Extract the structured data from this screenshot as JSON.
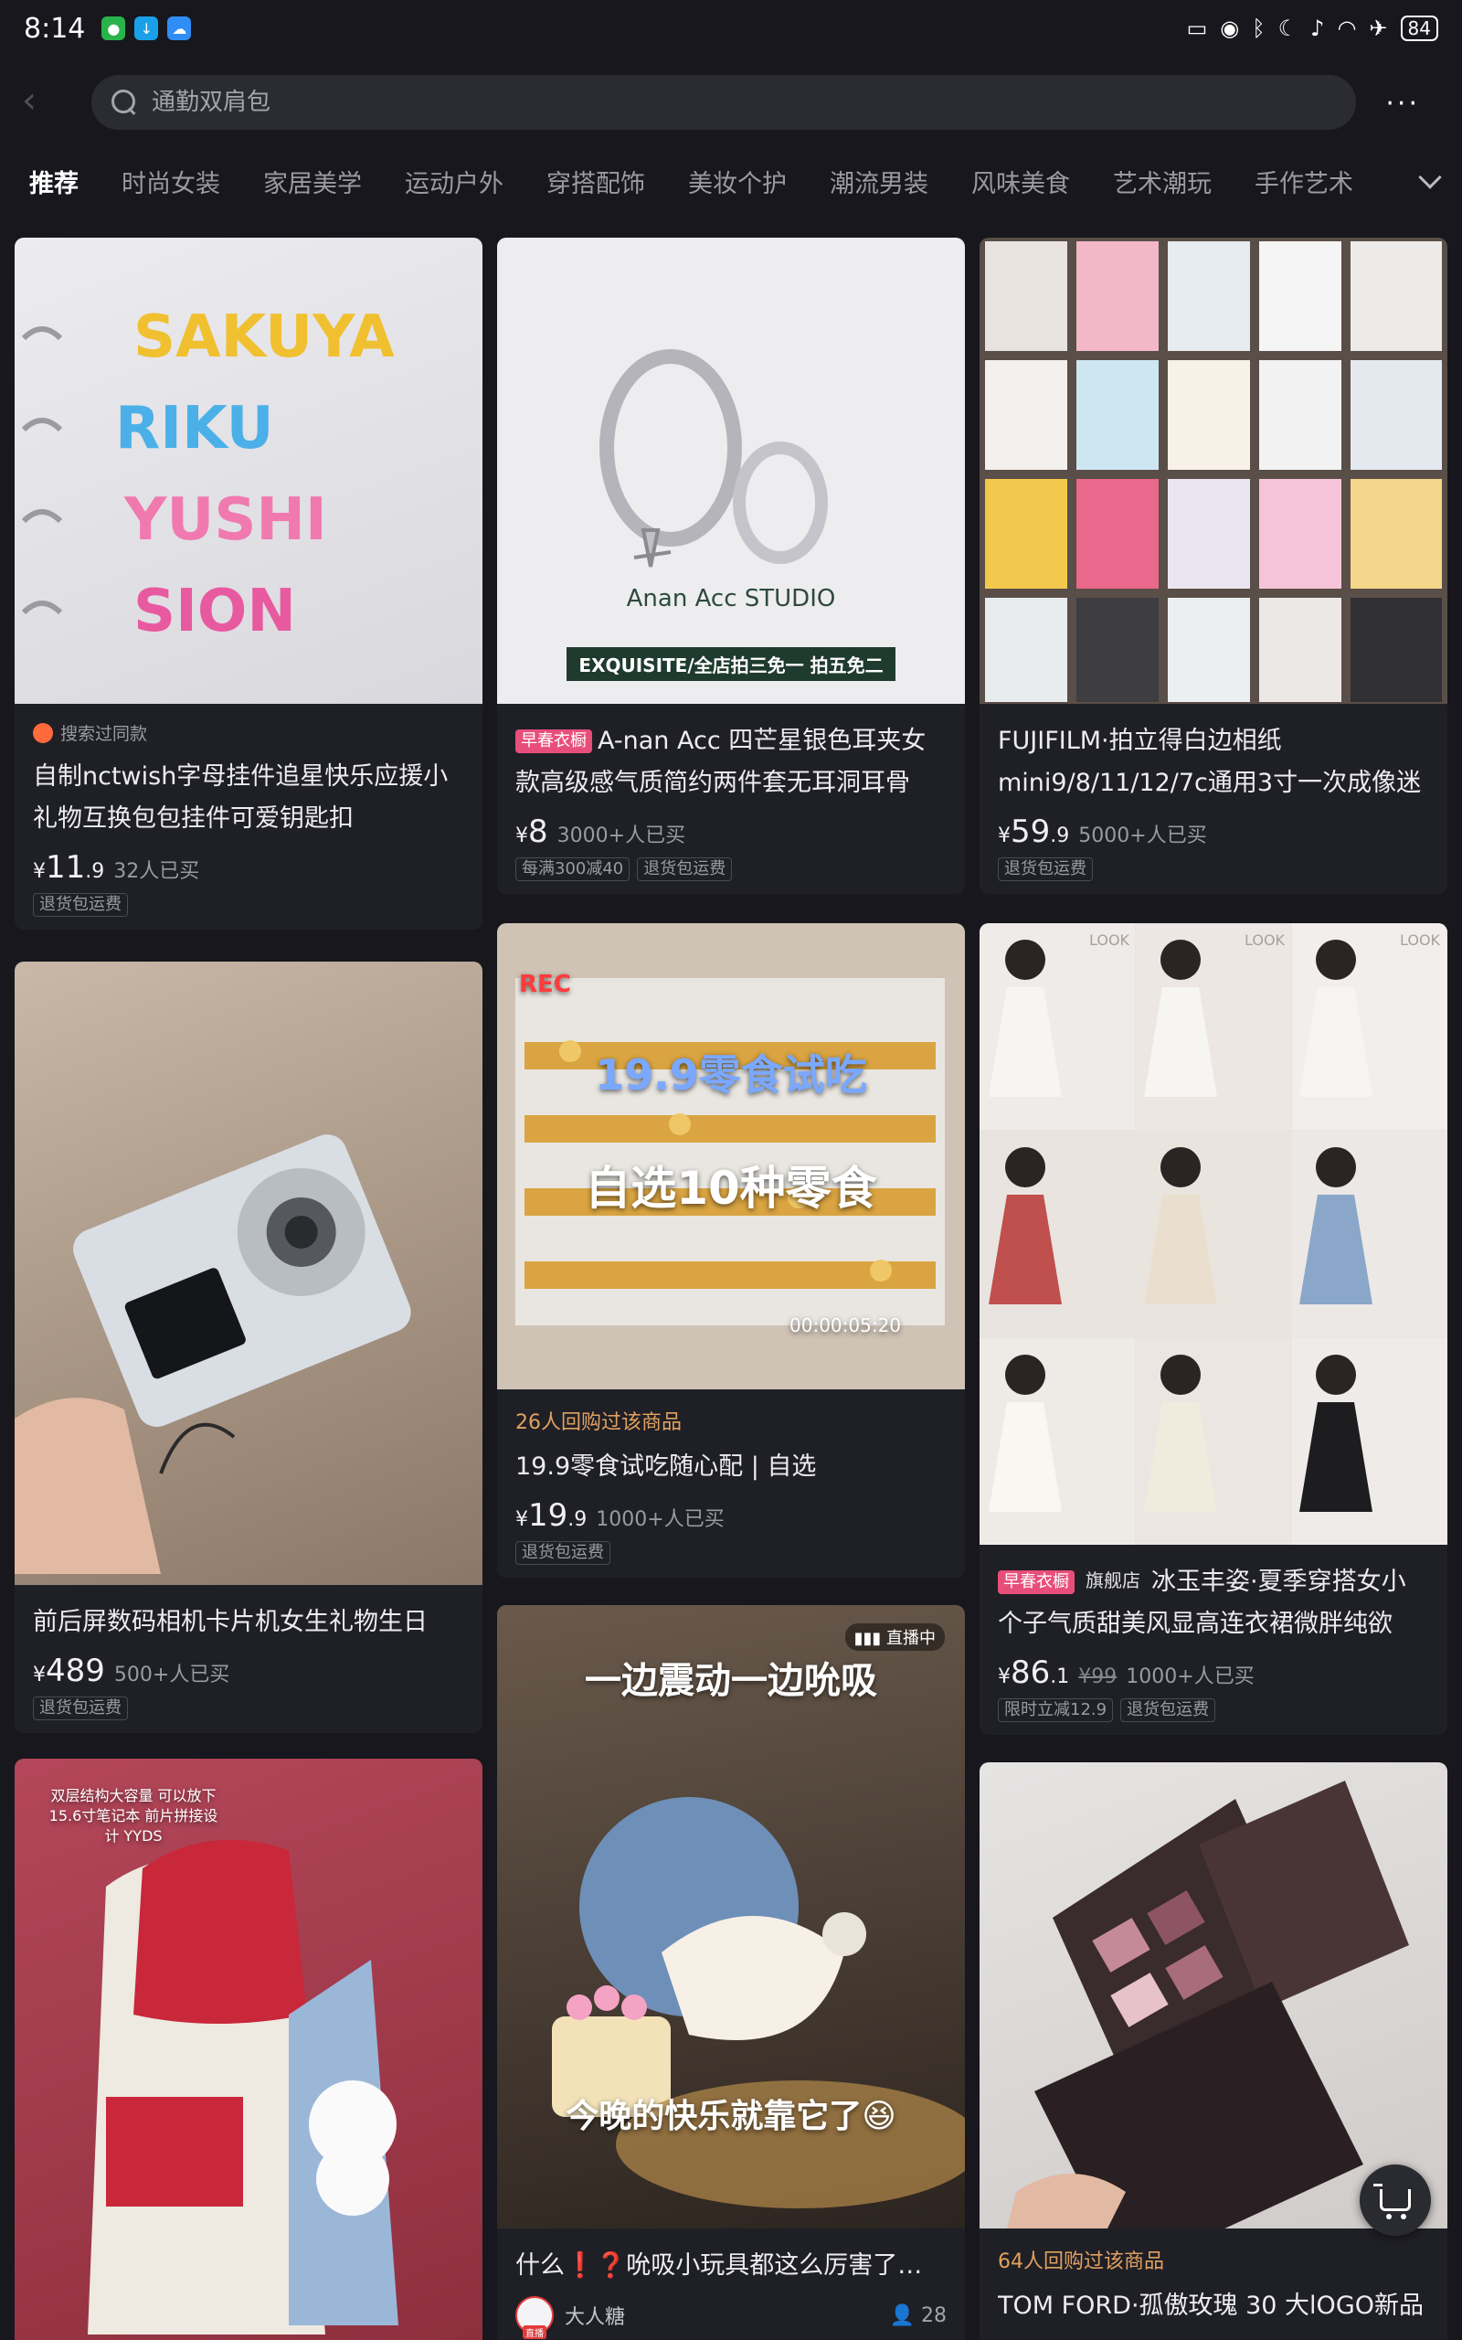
{
  "status_bar": {
    "time": "8:14",
    "battery": "84"
  },
  "search": {
    "placeholder": "通勤双肩包",
    "more": "···"
  },
  "tabs": [
    "推荐",
    "时尚女装",
    "家居美学",
    "运动户外",
    "穿搭配饰",
    "美妆个护",
    "潮流男装",
    "风味美食",
    "艺术潮玩",
    "手作艺术"
  ],
  "products": [
    {
      "meta": "搜索过同款",
      "title": "自制nctwish字母挂件追星快乐应援小礼物互换包包挂件可爱钥匙扣",
      "price_int": "11",
      "price_dec": ".9",
      "sold": "32人已买",
      "tags": [
        "退货包运费"
      ],
      "image_text": [
        "SAKUYA",
        "RIKU",
        "YUSHI",
        "SION"
      ]
    },
    {
      "badge": "早春衣橱",
      "title": "A-nan Acc 四芒星银色耳夹女款高级感气质简约两件套无耳洞耳骨",
      "price_int": "8",
      "price_dec": "",
      "sold": "3000+人已买",
      "tags": [
        "每满300减40",
        "退货包运费"
      ],
      "image_brand": "Anan Acc STUDIO",
      "image_banner": "EXQUISITE/全店拍三免一 拍五免二"
    },
    {
      "title": "FUJIFILM·拍立得白边相纸mini9/8/11/12/7c通用3寸一次成像迷",
      "price_int": "59",
      "price_dec": ".9",
      "sold": "5000+人已买",
      "tags": [
        "退货包运费"
      ]
    },
    {
      "title": "前后屏数码相机卡片机女生礼物生日",
      "price_int": "489",
      "price_dec": "",
      "sold": "500+人已买",
      "tags": [
        "退货包运费"
      ]
    },
    {
      "meta": "26人回购过该商品",
      "title": "19.9零食试吃随心配 | 自选",
      "price_int": "19",
      "price_dec": ".9",
      "sold": "1000+人已买",
      "tags": [
        "退货包运费"
      ],
      "image_rec": "REC",
      "image_line1": "19.9零食试吃",
      "image_line2": "自选10种零食",
      "image_time": "00:00:05:20"
    },
    {
      "badge": "早春衣橱",
      "store": "旗舰店",
      "title": "冰玉丰姿·夏季穿搭女小个子气质甜美风显高连衣裙微胖纯欲",
      "price_int": "86",
      "price_dec": ".1",
      "orig": "¥99",
      "sold": "1000+人已买",
      "tags": [
        "限时立减12.9",
        "退货包运费"
      ],
      "look": "LOOK"
    },
    {
      "image_text": "双层结构大容量 可以放下15.6寸笔记本 前片拼接设计 YYDS"
    },
    {
      "live": "直播中",
      "image_top": "一边震动一边吮吸",
      "image_bottom": "今晚的快乐就靠它了😆",
      "title": "什么❗❓吮吸小玩具都这么厉害了…",
      "author": "大人糖",
      "viewers": "28"
    },
    {
      "meta": "64人回购过该商品",
      "title": "TOM FORD·孤傲玫瑰 30 大lOGO新品"
    }
  ],
  "currency": "¥"
}
